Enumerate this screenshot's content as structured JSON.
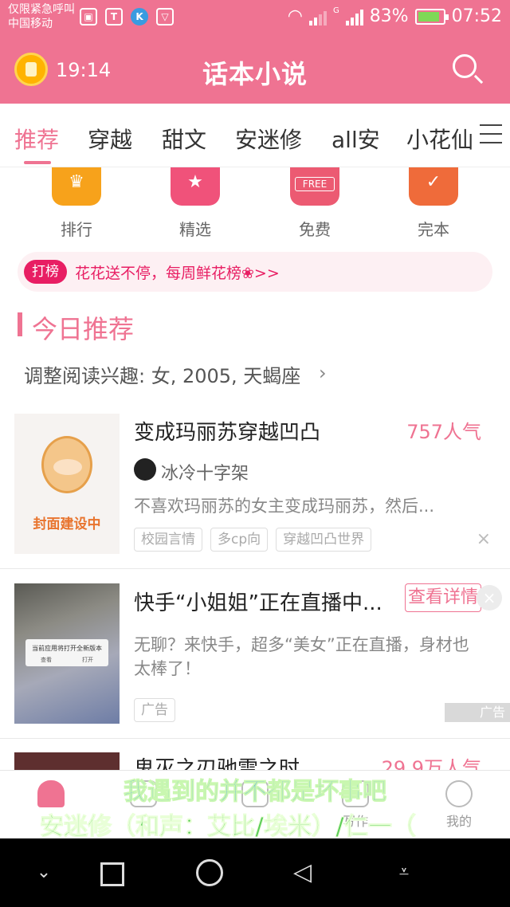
{
  "status": {
    "carrier_line1": "仅限紧急呼叫",
    "carrier_line2": "中国移动",
    "network_type": "G",
    "battery": "83%",
    "time": "07:52"
  },
  "header": {
    "clock_time": "19:14",
    "title": "话本小说"
  },
  "tabs": [
    "推荐",
    "穿越",
    "甜文",
    "安迷修",
    "all安",
    "小花仙"
  ],
  "categories": [
    {
      "label": "排行",
      "icon": "trophy-icon"
    },
    {
      "label": "精选",
      "icon": "star-icon"
    },
    {
      "label": "免费",
      "icon": "free-icon",
      "icon_text": "FREE"
    },
    {
      "label": "完本",
      "icon": "check-icon"
    }
  ],
  "banner": {
    "badge": "打榜",
    "text": "花花送不停，每周鲜花榜❀>>"
  },
  "section": {
    "title": "今日推荐",
    "preferences": "调整阅读兴趣: 女, 2005, 天蝎座",
    "arrow": "›"
  },
  "book1": {
    "cover_text": "封面建设中",
    "title": "变成玛丽苏穿越凹凸",
    "popularity": "757人气",
    "author": "冰冷十字架",
    "description": "不喜欢玛丽苏的女主变成玛丽苏，然后...",
    "tags": [
      "校园言情",
      "多cp向",
      "穿越凹凸世界"
    ],
    "close": "×"
  },
  "ad": {
    "cover_dialog": "当前应用将打开全新版本",
    "cover_btn_left": "查看",
    "cover_btn_right": "打开",
    "title": "快手“小姐姐”正在直播中...",
    "button": "查看详情",
    "close": "×",
    "description": "无聊？来快手，超多“美女”正在直播，身材也太棒了！",
    "tag": "广告",
    "corner": "广告"
  },
  "book2": {
    "title": "鬼灭之刃驰雷之时",
    "popularity": "29.9万人气"
  },
  "bottom_nav": [
    {
      "label": "",
      "icon": "home-icon",
      "active": true
    },
    {
      "label": "",
      "icon": "library-icon",
      "active": false
    },
    {
      "label": "",
      "icon": "discover-icon",
      "active": false
    },
    {
      "label": "写作",
      "icon": "write-icon",
      "active": false
    },
    {
      "label": "我的",
      "icon": "profile-icon",
      "active": false
    }
  ],
  "lyrics": {
    "line1": "我遇到的并不都是坏事吧",
    "line2": "安迷修（和声：艾比/埃米）/仁一（"
  },
  "colors": {
    "accent": "#ef7392",
    "badge": "#e81e63"
  }
}
